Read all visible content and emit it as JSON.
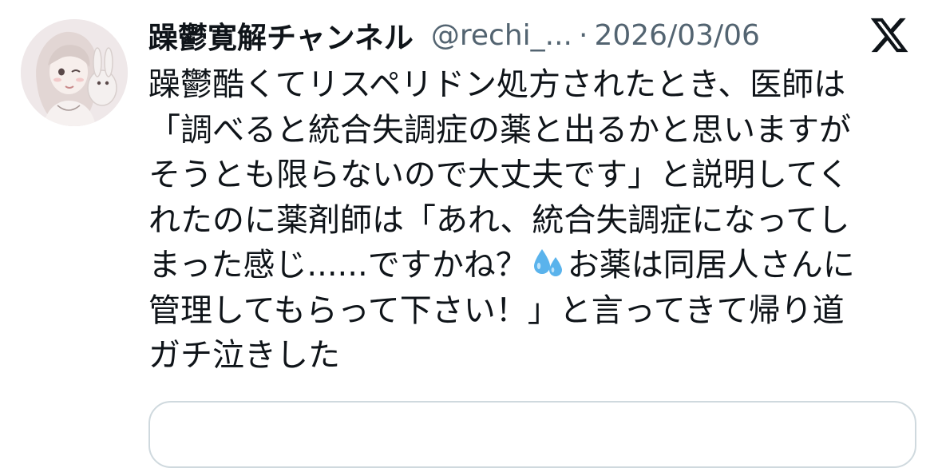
{
  "tweet": {
    "author": {
      "display_name": "躁鬱寛解チャンネル",
      "handle": "@rechi_...",
      "avatar_icon": "user-avatar-icon"
    },
    "separator": "·",
    "date": "2026/03/06",
    "platform_icon": "x-logo-icon",
    "text_lines": {
      "l1": "躁鬱酷くてリスペリドン処方されたとき、医師は",
      "l2": "「調べると統合失調症の薬と出るかと思いますが",
      "l3": "そうとも限らないので大丈夫です」と説明してく",
      "l4": "れたのに薬剤師は「あれ、統合失調症になってし",
      "l5a": "まった感じ......ですかね？",
      "l5b": "お薬は同居人さんに",
      "l6": "管理してもらって下さい！」と言ってきて帰り道",
      "l7": "ガチ泣きした"
    },
    "emoji_icon": "sweat-droplets-icon"
  },
  "colors": {
    "text_primary": "#0f1419",
    "text_secondary": "#536471",
    "border": "#cfd9de",
    "emoji_blue": "#5ab3ec"
  }
}
